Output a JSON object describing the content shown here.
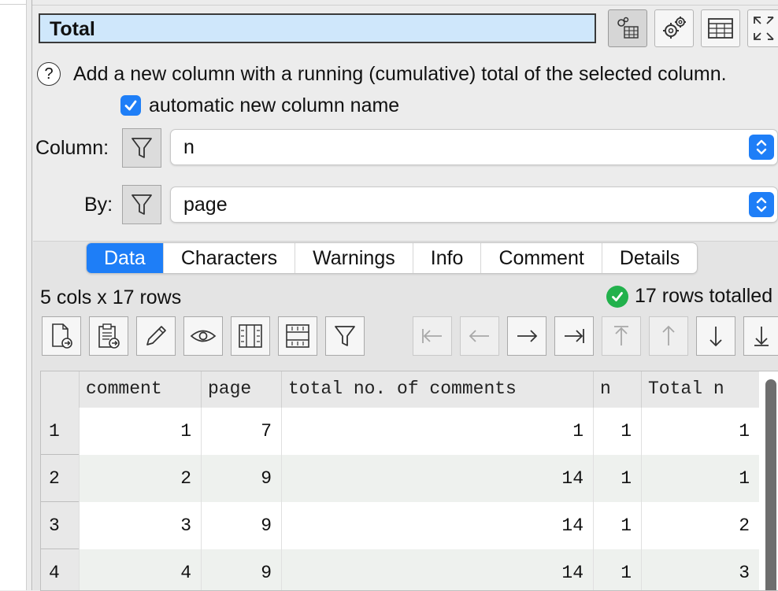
{
  "title": "Total",
  "help": {
    "icon_glyph": "?",
    "text": "Add a new column with a running (cumulative) total of the selected column."
  },
  "auto_name": {
    "checked": true,
    "label": "automatic new column name"
  },
  "column": {
    "label": "Column:",
    "value": "n"
  },
  "by": {
    "label": "By:",
    "value": "page"
  },
  "tabs": [
    {
      "label": "Data",
      "active": true
    },
    {
      "label": "Characters",
      "active": false
    },
    {
      "label": "Warnings",
      "active": false
    },
    {
      "label": "Info",
      "active": false
    },
    {
      "label": "Comment",
      "active": false
    },
    {
      "label": "Details",
      "active": false
    }
  ],
  "summary": {
    "dims": "5 cols x 17 rows",
    "status": "17 rows totalled"
  },
  "table": {
    "columns": [
      "comment",
      "page",
      "total no. of comments",
      "n",
      "Total n"
    ],
    "rows": [
      {
        "num": "1",
        "cells": [
          "1",
          "7",
          "1",
          "1",
          "1"
        ]
      },
      {
        "num": "2",
        "cells": [
          "2",
          "9",
          "14",
          "1",
          "1"
        ]
      },
      {
        "num": "3",
        "cells": [
          "3",
          "9",
          "14",
          "1",
          "2"
        ]
      },
      {
        "num": "4",
        "cells": [
          "4",
          "9",
          "14",
          "1",
          "3"
        ]
      }
    ]
  },
  "colors": {
    "accent": "#1e7ef7",
    "title_bg": "#cfe7fb",
    "ok": "#22b14c"
  }
}
